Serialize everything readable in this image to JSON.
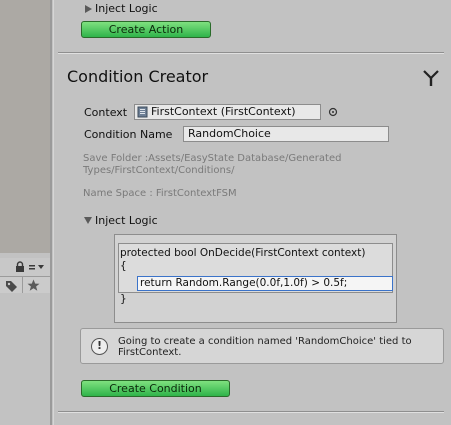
{
  "top_section": {
    "inject_logic_label": "Inject Logic",
    "create_action_label": "Create Action"
  },
  "condition_creator": {
    "title": "Condition Creator",
    "context_label": "Context",
    "context_value": "FirstContext (FirstContext)",
    "condition_name_label": "Condition Name",
    "condition_name_value": "RandomChoice",
    "save_folder_line1": "Save Folder :Assets/EasyState Database/Generated",
    "save_folder_line2": "Types/FirstContext/Conditions/",
    "name_space": "Name Space : FirstContextFSM",
    "inject_logic_label": "Inject Logic",
    "code": {
      "signature": "protected bool OnDecide(FirstContext context)",
      "open_brace": "{",
      "body": "return Random.Range(0.0f,1.0f) > 0.5f;",
      "close_brace": "}"
    },
    "info_line1": "Going to create a condition named 'RandomChoice' tied to",
    "info_line2": "FirstContext.",
    "create_condition_label": "Create Condition"
  },
  "icons": [
    "lock-icon",
    "menu-icon",
    "tag-icon",
    "star-icon",
    "fork-icon",
    "object-picker-icon",
    "script-icon",
    "info-icon"
  ],
  "colors": {
    "button_green": "#2fb34a",
    "input_focus": "#3b73c9",
    "panel_bg": "#c2c2c2"
  }
}
